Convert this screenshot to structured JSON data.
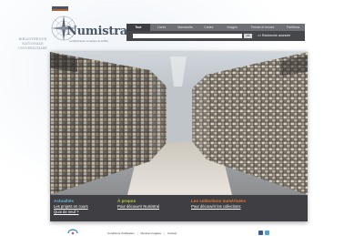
{
  "library": {
    "line1": "BIBLIOTHEQUE",
    "line2": "NATIONALE",
    "line3": "UNIVERSITAIRE"
  },
  "logo": {
    "name": "Numistral",
    "tagline": "La bibliothèque numérique de la BNU"
  },
  "nav": {
    "tabs": [
      "Tout",
      "Livres",
      "Manuscrits",
      "Cartes",
      "Images",
      "Presse et revues",
      "Partitions"
    ]
  },
  "search": {
    "placeholder": "",
    "ok_label": "OK",
    "advanced_label": ">> Recherche avancée"
  },
  "promo": {
    "columns": [
      {
        "heading": "Actualités",
        "color": "#6cb3d6",
        "links": [
          "Les projets en cours",
          "Quoi de neuf ?"
        ]
      },
      {
        "heading": "À propos",
        "color": "#b5cc3f",
        "links": [
          "Pour découvrir Numistral"
        ]
      },
      {
        "heading": "Les collections numérisées",
        "color": "#e4762e",
        "links": [
          "Pour découvrir les collections"
        ]
      }
    ]
  },
  "footer": {
    "partner": "Gallica",
    "links": [
      "Conditions d'utilisation",
      "Mentions légales",
      "Contact"
    ],
    "social": [
      {
        "name": "facebook-icon",
        "color": "#3b5998"
      },
      {
        "name": "twitter-icon",
        "color": "#4fa3d8"
      }
    ]
  }
}
